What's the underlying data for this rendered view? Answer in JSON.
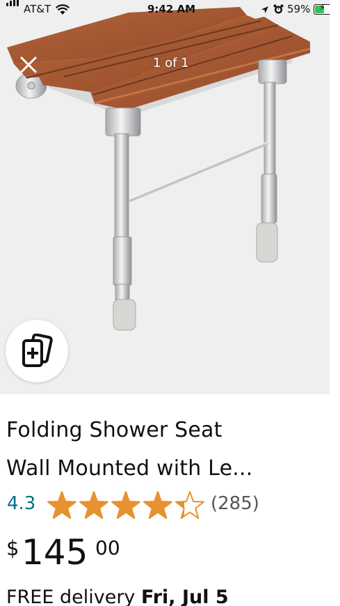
{
  "status_bar": {
    "carrier": "AT&T",
    "time": "9:42 AM",
    "battery_percent": "59%",
    "icons": [
      "signal-icon",
      "wifi-icon",
      "location-icon",
      "alarm-icon",
      "battery-charging-icon"
    ]
  },
  "image_viewer": {
    "counter": "1 of 1",
    "close_icon": "close-icon",
    "view_similar_icon": "view-similar-icon",
    "background_color": "#efefef"
  },
  "product": {
    "title_line1": "Folding Shower Seat",
    "title_line2": "Wall Mounted with Le...",
    "rating": "4.3",
    "rating_stars_value": 4.3,
    "rating_max": 5,
    "review_count": "(285)",
    "price_symbol": "$",
    "price_whole": "145",
    "price_fraction": "00",
    "delivery_prefix": "FREE delivery ",
    "delivery_date": "Fri, Jul 5"
  },
  "colors": {
    "star": "#e8912d",
    "rating_link": "#007185",
    "wood": "#a4572d",
    "battery": "#38c15a"
  }
}
